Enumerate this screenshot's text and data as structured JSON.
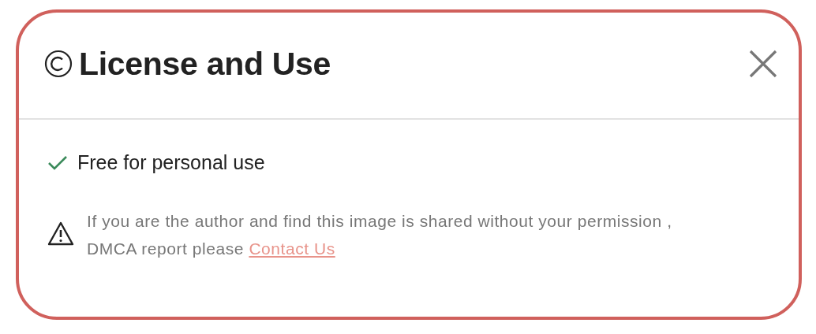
{
  "dialog": {
    "title": "License and Use",
    "features": [
      {
        "kind": "check",
        "label": "Free for personal use"
      }
    ],
    "notice": {
      "lines": [
        "If you are the author and find this image is shared without your permission ,",
        "DMCA report please"
      ],
      "link": "Contact Us"
    }
  }
}
